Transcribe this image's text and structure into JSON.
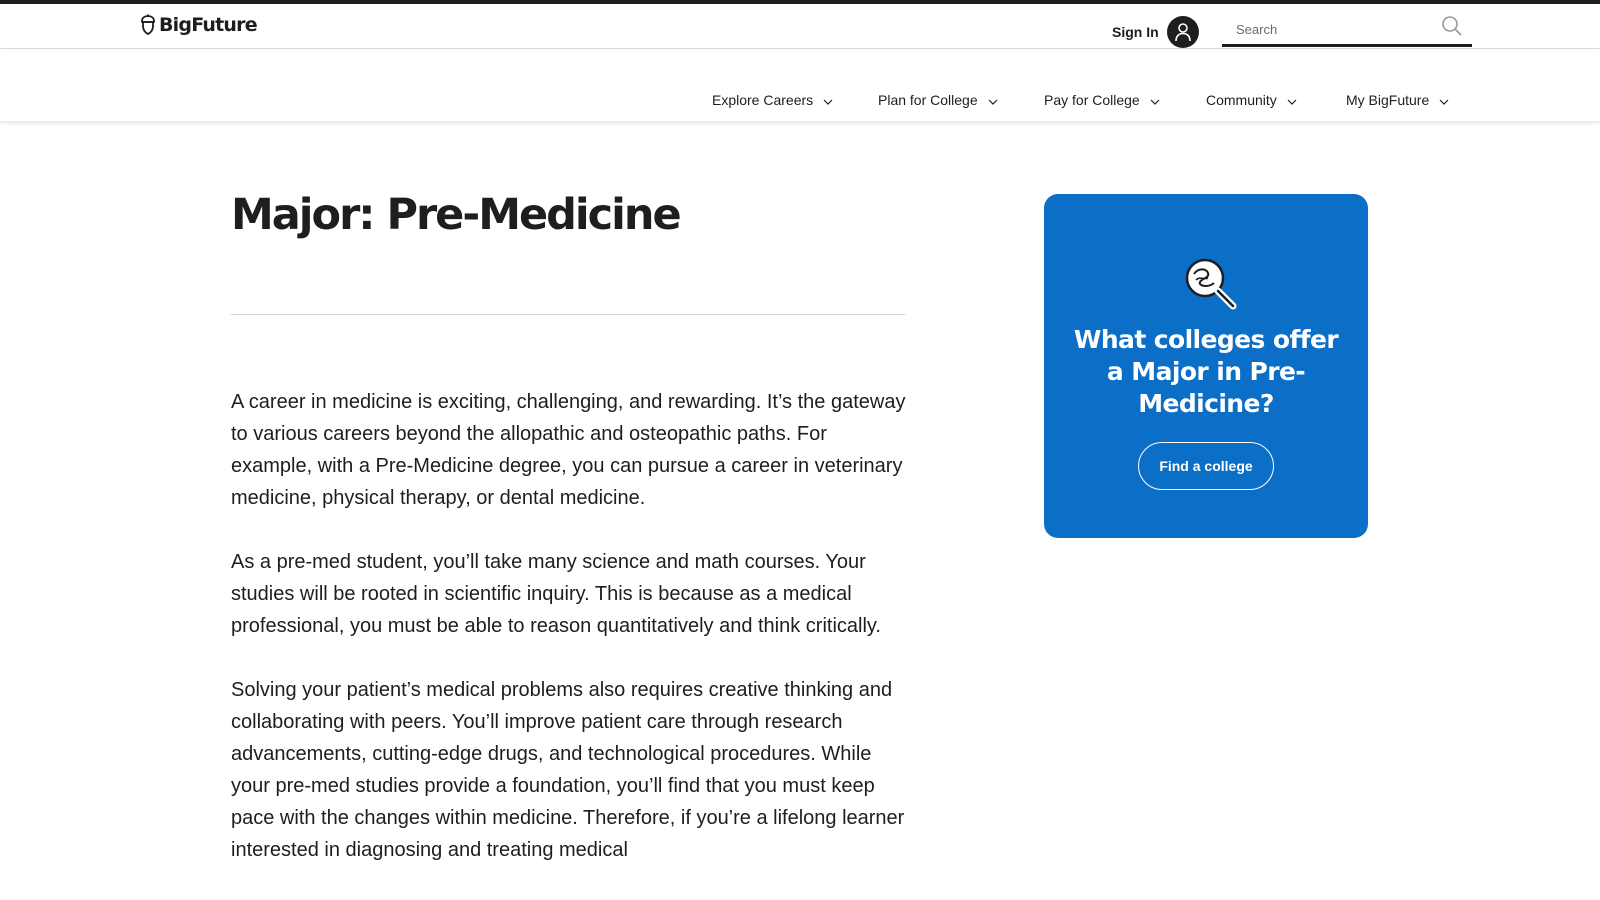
{
  "header": {
    "logo_text": "BigFuture",
    "sign_in_label": "Sign In",
    "search": {
      "placeholder": "Search"
    }
  },
  "nav": {
    "items": [
      {
        "label": "Explore Careers"
      },
      {
        "label": "Plan for College"
      },
      {
        "label": "Pay for College"
      },
      {
        "label": "Community"
      },
      {
        "label": "My BigFuture"
      }
    ]
  },
  "main": {
    "title": "Major: Pre-Medicine",
    "paragraphs": [
      "A career in medicine is exciting, challenging, and rewarding. It’s the gateway to various careers beyond the allopathic and osteopathic paths. For example, with a Pre-Medicine degree, you can pursue a career in veterinary medicine, physical therapy, or dental medicine.",
      "As a pre-med student, you’ll take many science and math courses. Your studies will be rooted in scientific inquiry. This is because as a medical professional, you must be able to reason quantitatively and think critically.",
      "Solving your patient’s medical problems also requires creative thinking and collaborating with peers. You’ll improve patient care through research advancements, cutting-edge drugs, and technological procedures. While your pre-med studies provide a foundation, you’ll find that you must keep pace with the changes within medicine. Therefore, if you’re a lifelong learner interested in diagnosing and treating medical"
    ]
  },
  "sidebar_card": {
    "title": "What colleges offer a Major in Pre-Medicine?",
    "button_label": "Find a college",
    "icon": "magnifying-glass-search-icon"
  },
  "colors": {
    "card_blue": "#0b6fc7",
    "text_dark": "#1e1e1e",
    "white": "#ffffff"
  }
}
